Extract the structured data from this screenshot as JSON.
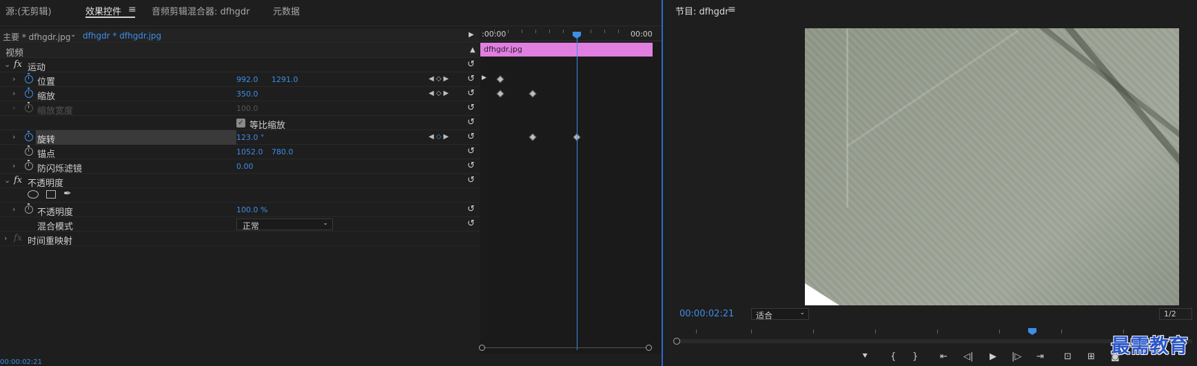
{
  "tabs": {
    "source": "源:(无剪辑)",
    "effect_controls": "效果控件",
    "audio_mixer": "音频剪辑混合器: dfhgdr",
    "metadata": "元数据"
  },
  "clipbar": {
    "master": "主要 * dfhgdr.jpg",
    "clip": "dfhgdr * dfhgdr.jpg"
  },
  "section": {
    "video": "视频",
    "motion": "运动",
    "opacity_group": "不透明度",
    "time_remap": "时间重映射"
  },
  "props": {
    "position": {
      "label": "位置",
      "x": "992.0",
      "y": "1291.0"
    },
    "scale": {
      "label": "缩放",
      "value": "350.0"
    },
    "scale_width": {
      "label": "缩放宽度",
      "value": "100.0"
    },
    "uniform_scale": "等比缩放",
    "rotation": {
      "label": "旋转",
      "value": "123.0 °"
    },
    "anchor": {
      "label": "锚点",
      "x": "1052.0",
      "y": "780.0"
    },
    "anti_flicker": {
      "label": "防闪烁滤镜",
      "value": "0.00"
    },
    "opacity": {
      "label": "不透明度",
      "value": "100.0 %"
    },
    "blend_mode": {
      "label": "混合模式",
      "value": "正常"
    }
  },
  "timeline": {
    "start": ":00:00",
    "end": "00:00",
    "clip_name": "dfhgdr.jpg"
  },
  "bottom_timecode": "00:00:02:21",
  "program": {
    "title": "节目: dfhgdr",
    "timecode": "00:00:02:21",
    "fit": "适合",
    "resolution": "1/2"
  },
  "watermark": "最需教育",
  "colors": {
    "accent": "#3d8ee8",
    "clip": "#e07fe0",
    "panel_border": "#2d6ad6"
  }
}
